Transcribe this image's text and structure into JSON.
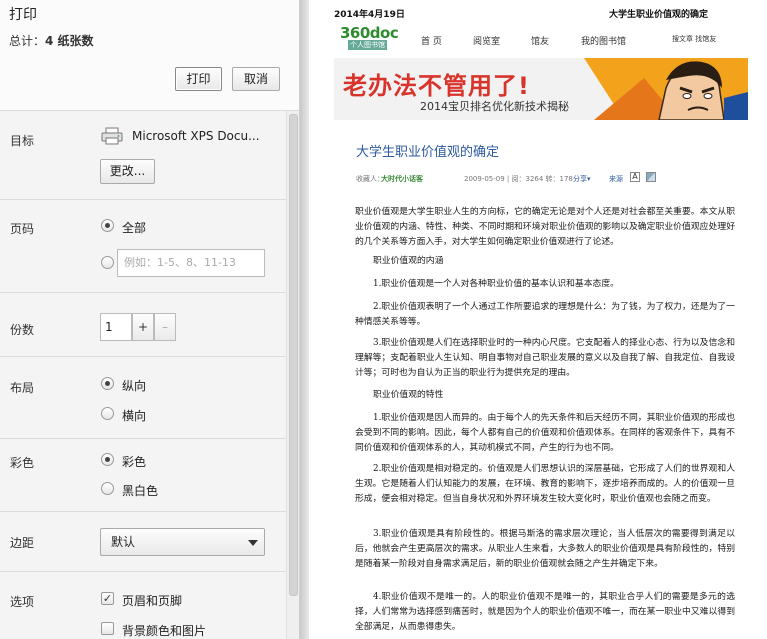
{
  "panel": {
    "title": "打印",
    "total_label": "总计：",
    "total_value": "4 纸张数",
    "print_button": "打印",
    "cancel_button": "取消",
    "destination": {
      "label": "目标",
      "printer_name": "Microsoft XPS Docu...",
      "change_button": "更改..."
    },
    "pages": {
      "label": "页码",
      "all_option": "全部",
      "range_placeholder": "例如：1-5、8、11-13"
    },
    "copies": {
      "label": "份数",
      "value": "1",
      "plus": "+",
      "minus": "–"
    },
    "layout": {
      "label": "布局",
      "portrait": "纵向",
      "landscape": "横向"
    },
    "color": {
      "label": "彩色",
      "color_option": "彩色",
      "bw_option": "黑白色"
    },
    "margins": {
      "label": "边距",
      "selected": "默认"
    },
    "options": {
      "label": "选项",
      "headers_footers": "页眉和页脚",
      "background": "背景颜色和图片"
    }
  },
  "preview": {
    "date": "2014年4月19日",
    "header_title": "大学生职业价值观的确定",
    "logo": "360doc",
    "logo_sub": "个人图书馆",
    "nav": [
      "首 页",
      "阅览室",
      "馆友",
      "我的图书馆"
    ],
    "nav_right": "搜文章 找馆友",
    "banner_headline": "老办法不管用了!",
    "banner_sub": "2014宝贝排名优化新技术揭秘",
    "article_title": "大学生职业价值观的确定",
    "meta": {
      "prefix": "收藏人：",
      "author": "大时代小话客",
      "info": "2009-05-09 | 阅：3264  转：178",
      "share": "分享▾",
      "source": "来源",
      "font_icon_label": "A"
    },
    "paragraphs": [
      "职业价值观是大学生职业人生的方向标，它的确定无论是对个人还是对社会都至关重要。本文从职业价值观的内涵、特性、种类、不同时期和环境对职业价值观的影响以及确定职业价值观应处理好的几个关系等方面入手，对大学生如何确定职业价值观进行了论述。",
      "职业价值观的内涵",
      "1.职业价值观是一个人对各种职业价值的基本认识和基本态度。",
      "2.职业价值观表明了一个人通过工作所要追求的理想是什么：为了钱，为了权力，还是为了一种情感关系等等。",
      "3.职业价值观是人们在选择职业时的一种内心尺度。它支配着人的择业心态、行为以及信念和理解等；支配着职业人生认知、明自事物对自己职业发展的意义以及自我了解、自我定位、自我设计等；可时也为自认为正当的职业行为提供充足的理由。",
      "职业价值观的特性",
      "1.职业价值观是因人而异的。由于每个人的先天条件和后天经历不同，其职业价值观的形成也会受到不同的影响。因此，每个人都有自己的价值观和价值观体系。在同样的客观条件下，具有不同价值观和价值观体系的人，其动机模式不同，产生的行为也不同。",
      "2.职业价值观是相对稳定的。价值观是人们思想认识的深层基础，它形成了人们的世界观和人生观。它是随着人们认知能力的发展，在环境、教育的影响下，逐步培养而成的。人的价值观一旦形成，便会相对稳定。但当自身状况和外界环境发生较大变化时，职业价值观也会随之而变。",
      "3.职业价值观是具有阶段性的。根据马斯洛的需求层次理论，当人低层次的需要得到满足以后，他就会产生更高层次的需求。从职业人生来看，大多数人的职业价值观是具有阶段性的，特别是随着某一阶段对自身需求满足后，新的职业价值观就会随之产生并确定下来。",
      "4.职业价值观不是唯一的。人的职业价值观不是唯一的，其职业合乎人们的需要是多元的选择，人们常常为选择感到痛苦时，就是因为个人的职业价值观不唯一，而在某一职业中又难以得到全部满足，从而患得患失。"
    ]
  }
}
